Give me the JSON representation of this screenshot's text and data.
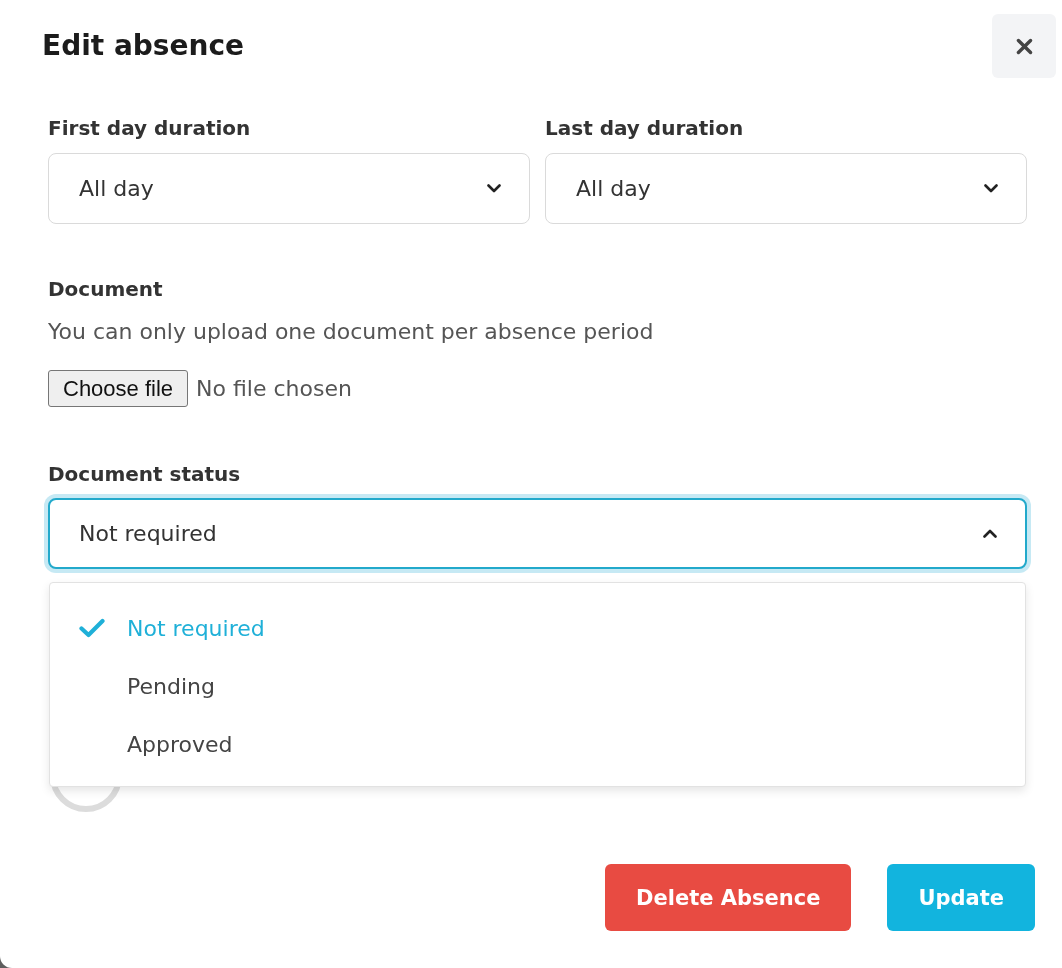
{
  "dialog": {
    "title": "Edit absence"
  },
  "fields": [
    {
      "kind": "select",
      "label": "First day duration",
      "value": "All day",
      "expanded": false
    },
    {
      "kind": "select",
      "label": "Last day duration",
      "value": "All day",
      "expanded": false
    }
  ],
  "document": {
    "label": "Document",
    "hint": "You can only upload one document per absence period",
    "file_button": "Choose file",
    "file_status": "No file chosen"
  },
  "document_status": {
    "label": "Document status",
    "value": "Not required",
    "expanded": true,
    "options": [
      {
        "label": "Not required",
        "selected": true
      },
      {
        "label": "Pending",
        "selected": false
      },
      {
        "label": "Approved",
        "selected": false
      }
    ]
  },
  "buttons": [
    {
      "label": "Delete Absence",
      "kind": "danger"
    },
    {
      "label": "Update",
      "kind": "primary"
    }
  ]
}
